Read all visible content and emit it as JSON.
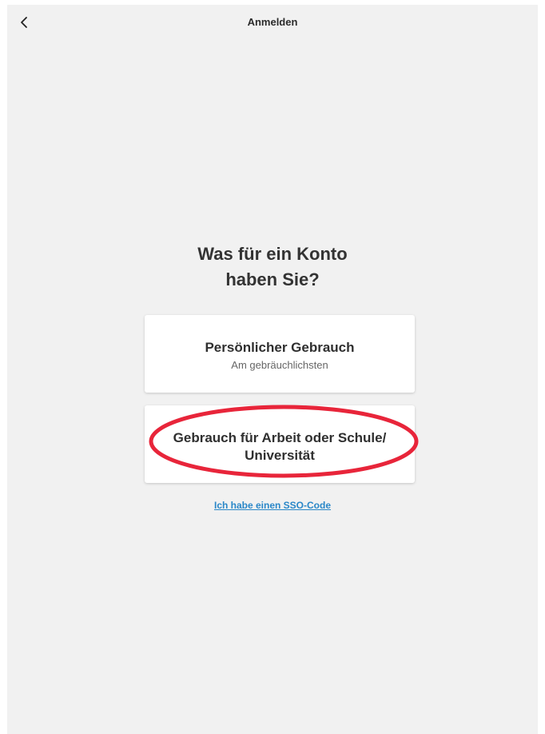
{
  "header": {
    "title": "Anmelden",
    "back_icon": "chevron-left-icon"
  },
  "question": {
    "line1": "Was für ein Konto",
    "line2": "haben Sie?"
  },
  "options": {
    "personal": {
      "title": "Persönlicher Gebrauch",
      "subtitle": "Am gebräuchlichsten"
    },
    "work": {
      "title_line1": "Gebrauch für Arbeit oder Schule/",
      "title_line2": "Universität"
    }
  },
  "sso_link": "Ich habe einen SSO-Code",
  "colors": {
    "background": "#f1f1f1",
    "card": "#ffffff",
    "link": "#2a87c8",
    "highlight": "#e8253a"
  }
}
